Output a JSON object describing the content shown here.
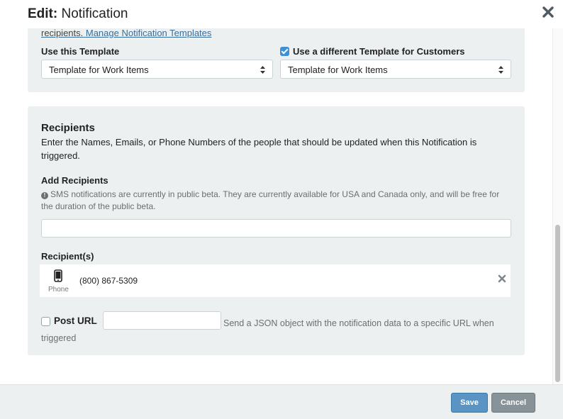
{
  "header": {
    "title_prefix": "Edit:",
    "title": "Notification",
    "close_icon": "close-icon"
  },
  "template_section": {
    "cut_off_text_lead": "recipients.",
    "manage_link": "Manage Notification Templates",
    "use_template_label": "Use this Template",
    "use_template_value": "Template for Work Items",
    "different_template_checked": true,
    "different_template_label": "Use a different Template for Customers",
    "customer_template_value": "Template for Work Items"
  },
  "recipients": {
    "heading": "Recipients",
    "description": "Enter the Names, Emails, or Phone Numbers of the people that should be updated when this Notification is triggered.",
    "add_label": "Add Recipients",
    "sms_note": "SMS notifications are currently in public beta. They are currently available for USA and Canada only, and will be free for the duration of the public beta.",
    "add_input_value": "",
    "list_label": "Recipient(s)",
    "list": [
      {
        "type_label": "Phone",
        "value": "(800) 867-5309",
        "icon": "phone-icon"
      }
    ]
  },
  "post_url": {
    "checked": false,
    "label": "Post URL",
    "input_value": "",
    "help": "Send a JSON object with the notification data to a specific URL when triggered"
  },
  "footer": {
    "save_label": "Save",
    "cancel_label": "Cancel"
  },
  "colors": {
    "panel_bg": "#ecf0f1",
    "save_button": "#5a94c4",
    "cancel_button": "#879398",
    "checkbox_checked": "#3d8fd6",
    "link": "#3a6e9a"
  }
}
